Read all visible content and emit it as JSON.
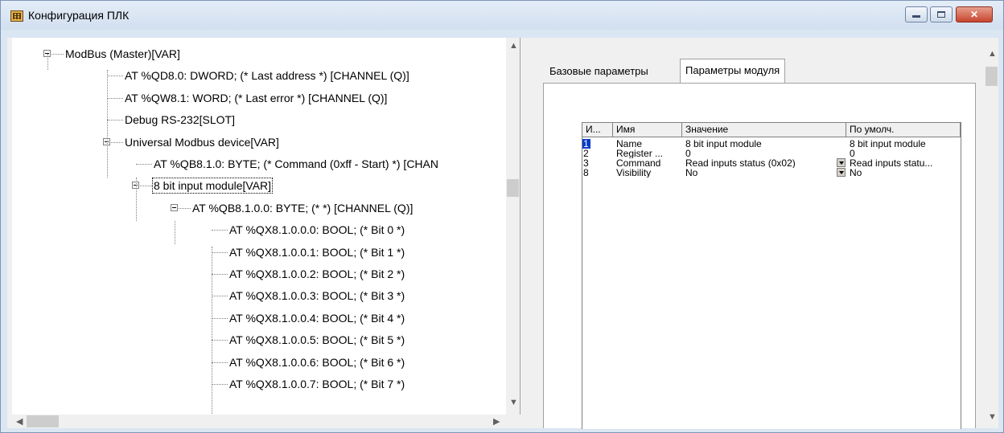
{
  "window": {
    "title": "Конфигурация ПЛК",
    "controls": {
      "minimize": "minimize",
      "maximize": "maximize",
      "close": "✕"
    }
  },
  "tree": {
    "nodes": [
      {
        "label": "ModBus (Master)[VAR]",
        "level": 0,
        "expanded": true
      },
      {
        "label": "AT %QD8.0: DWORD; (* Last address *) [CHANNEL (Q)]",
        "level": 1
      },
      {
        "label": "AT %QW8.1: WORD; (* Last error *) [CHANNEL (Q)]",
        "level": 1
      },
      {
        "label": "Debug RS-232[SLOT]",
        "level": 1
      },
      {
        "label": "Universal Modbus device[VAR]",
        "level": 1,
        "expanded": true
      },
      {
        "label": "AT %QB8.1.0: BYTE; (* Command (0xff - Start) *) [CHAN",
        "level": 2
      },
      {
        "label": "8 bit input module[VAR]",
        "level": 2,
        "expanded": true,
        "selected": true
      },
      {
        "label": "AT %QB8.1.0.0: BYTE; (*  *) [CHANNEL (Q)]",
        "level": 3,
        "expanded": true
      },
      {
        "label": "AT %QX8.1.0.0.0: BOOL; (* Bit 0 *)",
        "level": 4
      },
      {
        "label": "AT %QX8.1.0.0.1: BOOL; (* Bit 1 *)",
        "level": 4
      },
      {
        "label": "AT %QX8.1.0.0.2: BOOL; (* Bit 2 *)",
        "level": 4
      },
      {
        "label": "AT %QX8.1.0.0.3: BOOL; (* Bit 3 *)",
        "level": 4
      },
      {
        "label": "AT %QX8.1.0.0.4: BOOL; (* Bit 4 *)",
        "level": 4
      },
      {
        "label": "AT %QX8.1.0.0.5: BOOL; (* Bit 5 *)",
        "level": 4
      },
      {
        "label": "AT %QX8.1.0.0.6: BOOL; (* Bit 6 *)",
        "level": 4
      },
      {
        "label": "AT %QX8.1.0.0.7: BOOL; (* Bit 7 *)",
        "level": 4
      }
    ]
  },
  "tabs": [
    {
      "label": "Базовые параметры",
      "active": false
    },
    {
      "label": "Параметры модуля",
      "active": true
    }
  ],
  "params_table": {
    "headers": [
      "И...",
      "Имя",
      "Значение",
      "По умолч."
    ],
    "rows": [
      {
        "idx": "1",
        "name": "Name",
        "value": "8 bit input module",
        "default": "8 bit input module",
        "selected": true,
        "dropdown": false
      },
      {
        "idx": "2",
        "name": "Register ...",
        "value": "0",
        "default": "0",
        "selected": false,
        "dropdown": false
      },
      {
        "idx": "3",
        "name": "Command",
        "value": "Read inputs status  (0x02)",
        "default": "Read inputs statu...",
        "selected": false,
        "dropdown": true
      },
      {
        "idx": "8",
        "name": "Visibility",
        "value": "No",
        "default": "No",
        "selected": false,
        "dropdown": true
      }
    ]
  },
  "colors": {
    "selection": "#0a3cc8",
    "titlebar": "#dbe6f3",
    "close": "#c7452d"
  }
}
